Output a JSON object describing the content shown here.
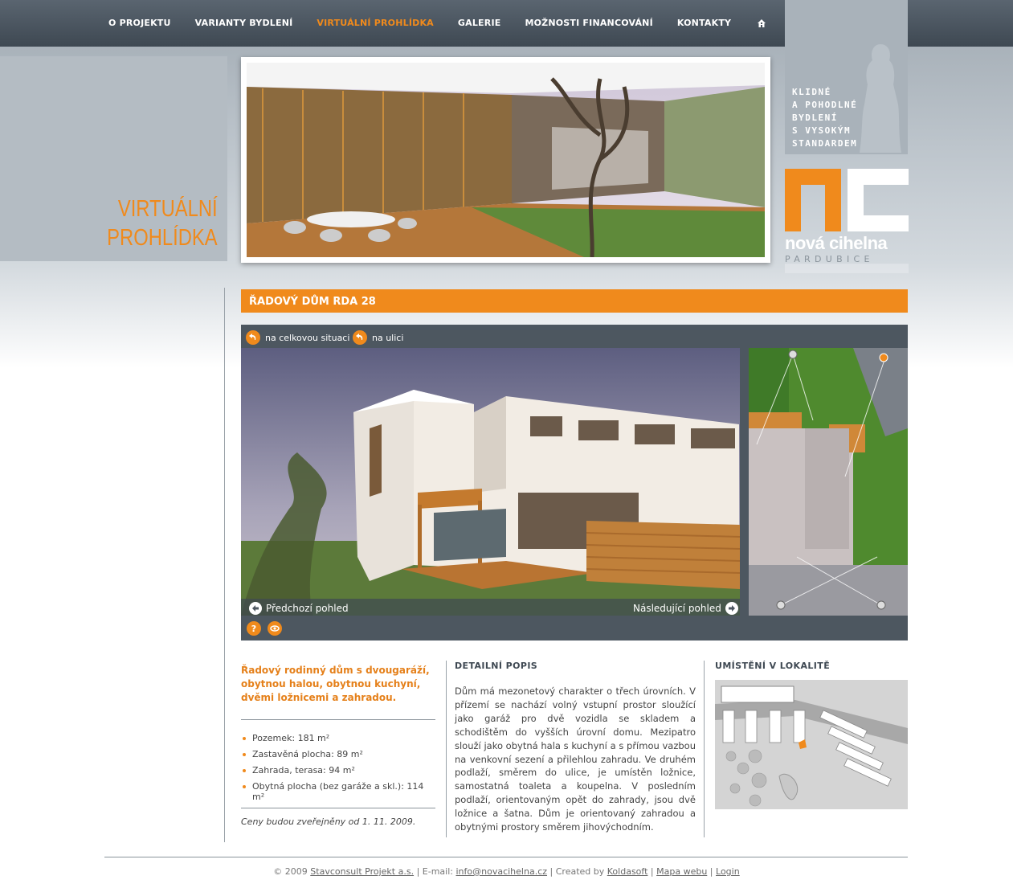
{
  "nav": {
    "items": [
      {
        "label": "O PROJEKTU"
      },
      {
        "label": "VARIANTY BYDLENÍ"
      },
      {
        "label": "VIRTUÁLNÍ PROHLÍDKA"
      },
      {
        "label": "GALERIE"
      },
      {
        "label": "MOŽNOSTI FINANCOVÁNÍ"
      },
      {
        "label": "KONTAKTY"
      }
    ],
    "active_index": 2,
    "home_icon": "home-icon"
  },
  "hero": {
    "section_title_line1": "VIRTUÁLNÍ",
    "section_title_line2": "PROHLÍDKA",
    "tagline": [
      "KLIDNÉ",
      "A POHODLNÉ",
      "BYDLENÍ",
      "S VYSOKÝM",
      "STANDARDEM"
    ],
    "logo_letters": "nc",
    "logo_name": "nová cihelna",
    "logo_city": "PARDUBICE"
  },
  "house": {
    "title": "ŘADOVÝ DŮM RDA 28"
  },
  "viewer": {
    "link_overall": "na celkovou situaci",
    "link_street": "na ulici",
    "prev_label": "Předchozí pohled",
    "next_label": "Následující pohled",
    "help_icon": "help-icon",
    "eye_icon": "eye-icon"
  },
  "summary": {
    "lead": "Řadový rodinný dům s dvougaráží, obytnou halou, obytnou kuchyní, dvěmi ložnicemi a zahradou.",
    "specs": [
      {
        "label": "Pozemek: 181 m²"
      },
      {
        "label": "Zastavěná plocha: 89 m²"
      },
      {
        "label": "Zahrada, terasa: 94 m²"
      },
      {
        "label": "Obytná plocha (bez garáže a skl.): 114 m²"
      }
    ],
    "price_note": "Ceny budou zveřejněny od 1. 11. 2009."
  },
  "detail": {
    "heading": "DETAILNÍ POPIS",
    "text": "Dům má mezonetový charakter o třech úrovních. V přízemí se nachází volný vstupní prostor sloužící jako garáž pro dvě vozidla se skladem a schodištěm do vyšších úrovní domu. Mezipatro slouží jako obytná hala s kuchyní a s přímou vazbou na venkovní sezení a přilehlou zahradu. Ve druhém podlaží, směrem do ulice, je umístěn ložnice, samostatná toaleta a koupelna. V posledním podlaží, orientovaným opět do zahrady, jsou dvě ložnice a šatna. Dům je orientovaný zahradou a obytnými prostory směrem jihovýchodním."
  },
  "location": {
    "heading": "UMÍSTĚNÍ V LOKALITĚ"
  },
  "footer": {
    "copyright": "© 2009",
    "company": "Stavconsult Projekt a.s.",
    "email_label": "E-mail:",
    "email": "info@novacihelna.cz",
    "created_by": "Created by",
    "creator": "Koldasoft",
    "sitemap": "Mapa webu",
    "login": "Login"
  },
  "colors": {
    "accent": "#f08a1c",
    "nav_bg": "#4a545e",
    "viewer_bg": "#4d5760"
  }
}
